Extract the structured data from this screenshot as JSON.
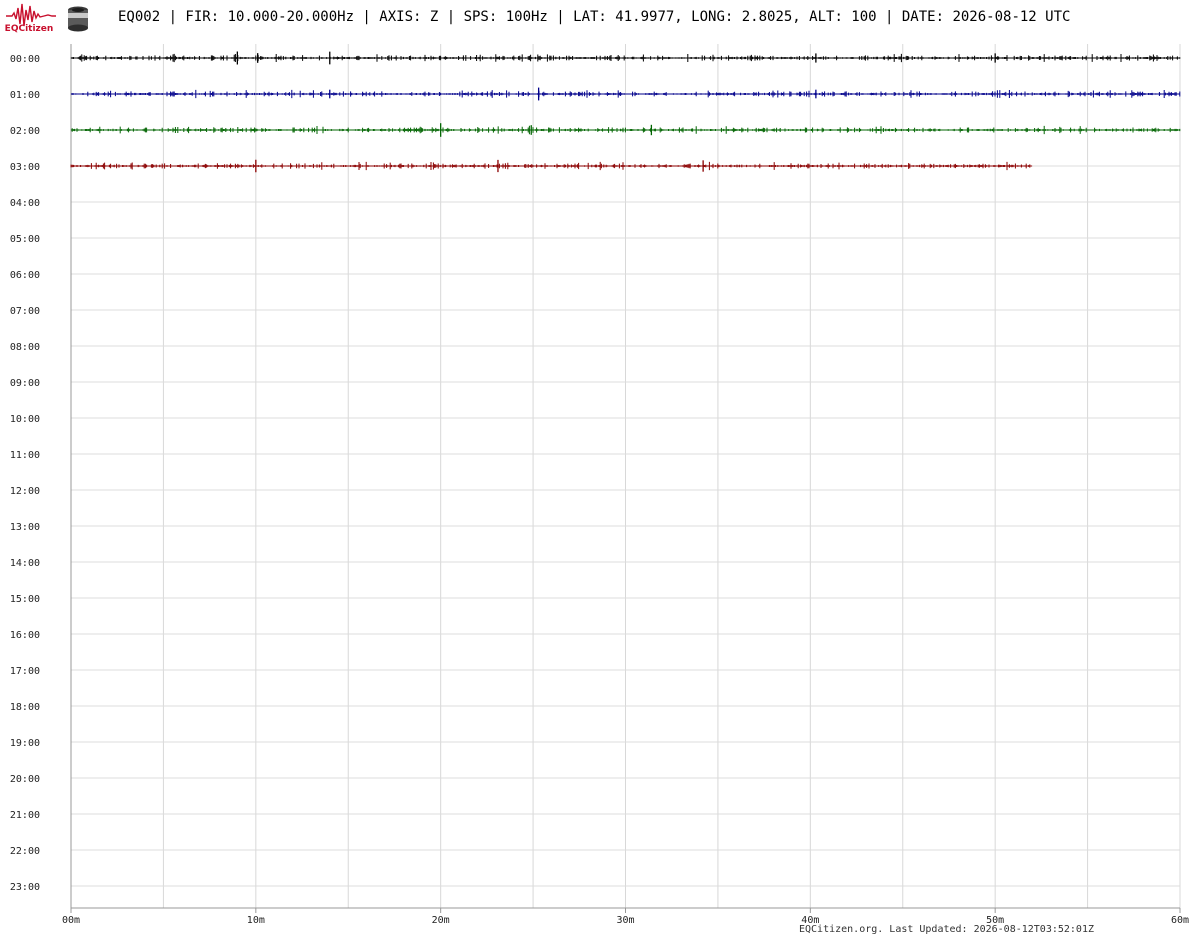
{
  "header": {
    "logo_text": "EQCitizen",
    "station_line": "EQ002 | FIR: 10.000-20.000Hz | AXIS: Z | SPS: 100Hz | LAT: 41.9977, LONG: 2.8025, ALT: 100 | DATE: 2026-08-12 UTC"
  },
  "footer": {
    "credit": "EQCitizen.org. Last Updated: 2026-08-12T03:52:01Z"
  },
  "chart_data": {
    "type": "line",
    "title": "",
    "xlabel": "",
    "ylabel": "",
    "x_ticks": [
      "00m",
      "10m",
      "20m",
      "30m",
      "40m",
      "50m",
      "60m"
    ],
    "x_range_minutes": [
      0,
      60
    ],
    "x_minor_step_minutes": 5,
    "y_rows": [
      "00:00",
      "01:00",
      "02:00",
      "03:00",
      "04:00",
      "05:00",
      "06:00",
      "07:00",
      "08:00",
      "09:00",
      "10:00",
      "11:00",
      "12:00",
      "13:00",
      "14:00",
      "15:00",
      "16:00",
      "17:00",
      "18:00",
      "19:00",
      "20:00",
      "21:00",
      "22:00",
      "23:00"
    ],
    "grid": true,
    "series": [
      {
        "row": "00:00",
        "color": "#000000",
        "start_minute": 0,
        "end_minute": 60,
        "spikes_minute": [
          9.0,
          10.1,
          14.0,
          40.3,
          50.0
        ]
      },
      {
        "row": "01:00",
        "color": "#00008b",
        "start_minute": 0,
        "end_minute": 60,
        "spikes_minute": [
          14.0,
          25.3,
          40.3
        ]
      },
      {
        "row": "02:00",
        "color": "#006400",
        "start_minute": 0,
        "end_minute": 60,
        "spikes_minute": [
          20.0,
          24.9,
          31.4
        ]
      },
      {
        "row": "03:00",
        "color": "#8b0000",
        "start_minute": 0,
        "end_minute": 52,
        "spikes_minute": [
          10.0,
          23.1,
          34.2
        ]
      }
    ]
  }
}
